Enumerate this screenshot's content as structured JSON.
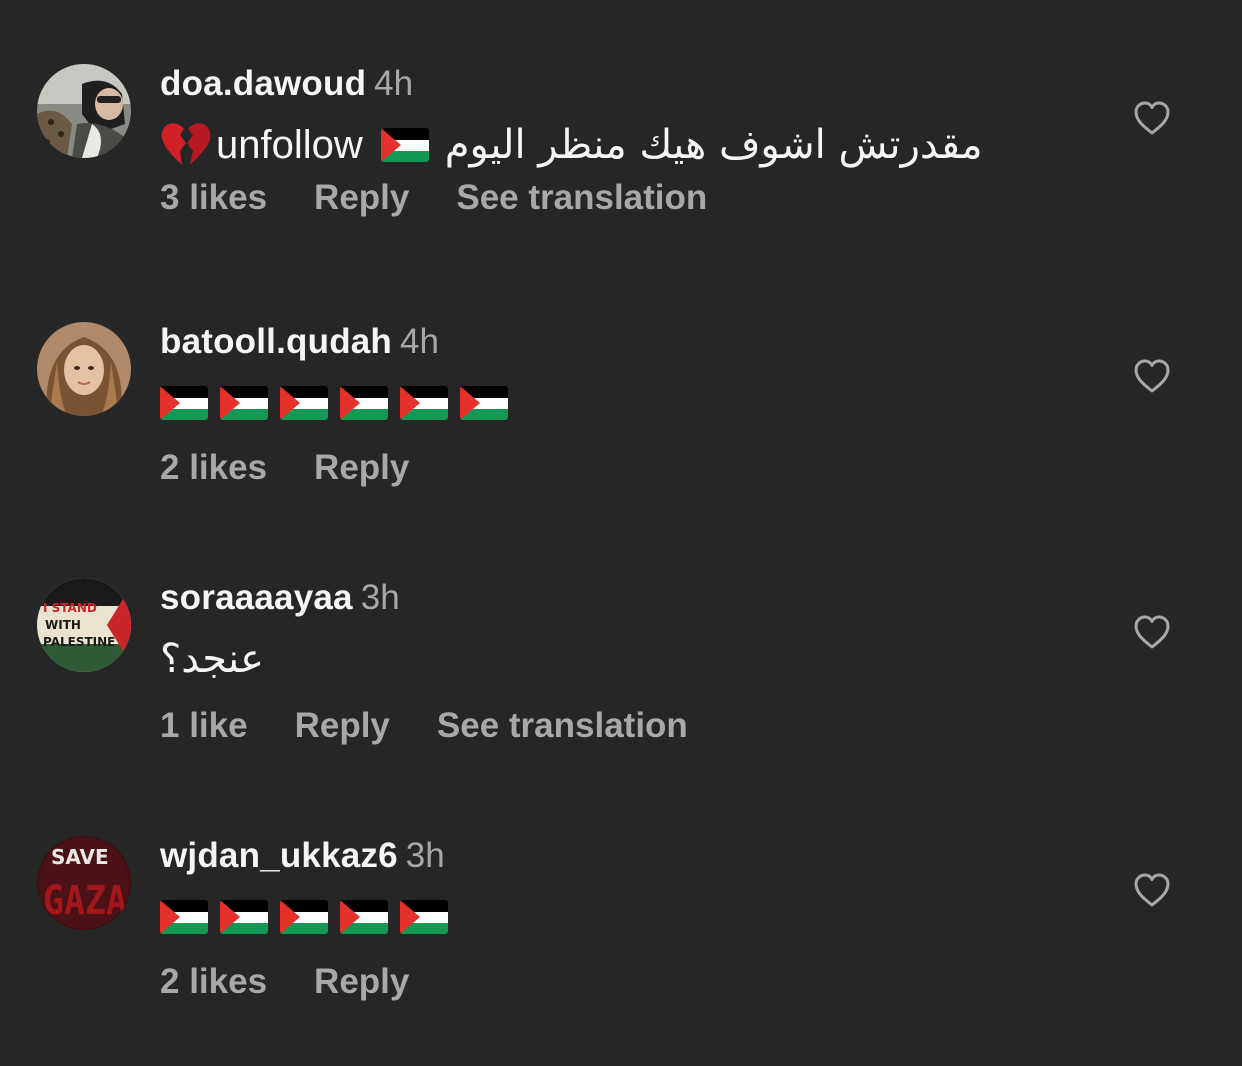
{
  "comments": [
    {
      "username": "doa.dawoud",
      "time": "4h",
      "text_before_flag": "unfollow",
      "text_arabic": "مقدرتش اشوف هيك منظر اليوم",
      "likes": "3 likes",
      "reply": "Reply",
      "translation": "See translation",
      "avatar_icon": "profile-photo"
    },
    {
      "username": "batooll.qudah",
      "time": "4h",
      "flag_count": 6,
      "likes": "2 likes",
      "reply": "Reply",
      "avatar_icon": "profile-photo"
    },
    {
      "username": "soraaaayaa",
      "time": "3h",
      "text_arabic": "عنجد؟",
      "likes": "1 like",
      "reply": "Reply",
      "translation": "See translation",
      "avatar_icon": "stand-with-palestine-badge",
      "avatar_text": [
        "I STAND",
        "WITH",
        "PALESTINE"
      ]
    },
    {
      "username": "wjdan_ukkaz6",
      "time": "3h",
      "flag_count": 5,
      "likes": "2 likes",
      "reply": "Reply",
      "avatar_icon": "save-gaza-badge",
      "avatar_text": [
        "SAVE",
        "GAZA"
      ]
    }
  ],
  "colors": {
    "background": "#262626",
    "primary_text": "#f5f5f5",
    "secondary_text": "#a8a8a8",
    "flag_red": "#e4312b",
    "flag_green": "#149954",
    "flag_black": "#000000",
    "flag_white": "#ffffff"
  }
}
